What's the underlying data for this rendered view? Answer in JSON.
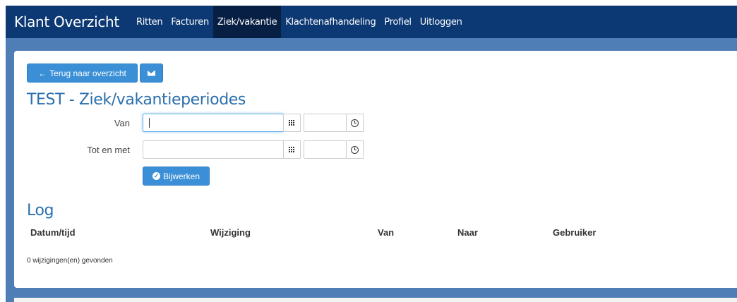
{
  "navbar": {
    "brand": "Klant Overzicht",
    "items": [
      {
        "label": "Ritten"
      },
      {
        "label": "Facturen"
      },
      {
        "label": "Ziek/vakantie",
        "active": true
      },
      {
        "label": "Klachtenafhandeling"
      },
      {
        "label": "Profiel"
      },
      {
        "label": "Uitloggen"
      }
    ],
    "color": "#0c3873",
    "active_color": "#081f44"
  },
  "toolbar": {
    "back_label": "Terug naar overzicht",
    "back_icon": "arrow-left-icon",
    "mail_icon": "envelope-icon"
  },
  "page": {
    "title": "TEST - Ziek/vakantieperiodes",
    "accent_color": "#2b6fac",
    "band_color": "#4f7db5"
  },
  "form": {
    "from_label": "Van",
    "to_label": "Tot en met",
    "from_date_value": "",
    "from_time_value": "",
    "to_date_value": "",
    "to_time_value": "",
    "calendar_icon": "calendar-grid-icon",
    "time_icon": "clock-icon",
    "submit_label": "Bijwerken",
    "submit_icon": "check-circle-icon"
  },
  "log": {
    "title": "Log",
    "columns": [
      "Datum/tijd",
      "Wijziging",
      "Van",
      "Naar",
      "Gebruiker"
    ],
    "rows": [],
    "count_text": "0 wijzigingen(en) gevonden"
  }
}
